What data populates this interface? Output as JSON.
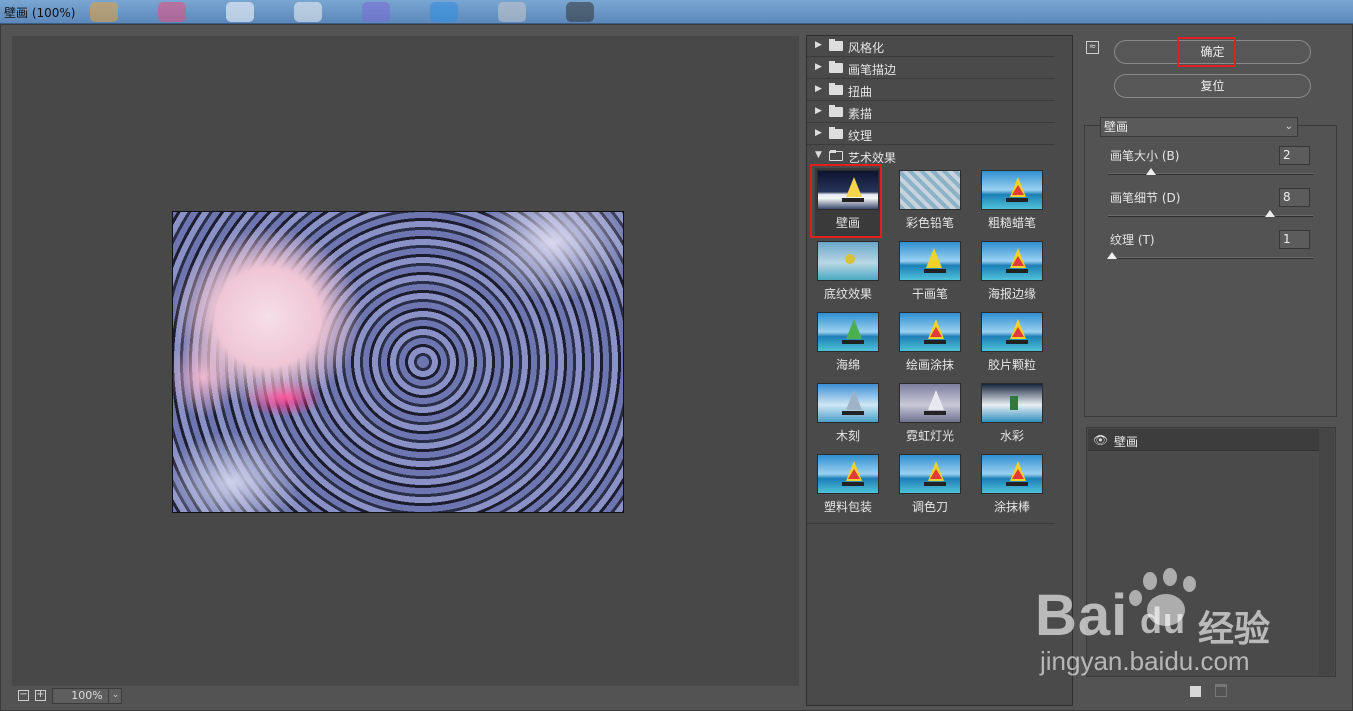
{
  "window": {
    "title": "壁画 (100%)"
  },
  "preview": {
    "zoom": "100%",
    "zoom_out": "−",
    "zoom_in": "+",
    "dropdown": "⌄"
  },
  "gallery": {
    "folders": [
      {
        "label": "风格化",
        "arrow": "▶"
      },
      {
        "label": "画笔描边",
        "arrow": "▶"
      },
      {
        "label": "扭曲",
        "arrow": "▶"
      },
      {
        "label": "素描",
        "arrow": "▶"
      },
      {
        "label": "纹理",
        "arrow": "▶"
      },
      {
        "label": "艺术效果",
        "arrow": "▼"
      }
    ],
    "filters": [
      "壁画",
      "彩色铅笔",
      "粗糙蜡笔",
      "底纹效果",
      "干画笔",
      "海报边缘",
      "海绵",
      "绘画涂抹",
      "胶片颗粒",
      "木刻",
      "霓虹灯光",
      "水彩",
      "塑料包装",
      "调色刀",
      "涂抹棒"
    ],
    "selected": "壁画"
  },
  "buttons": {
    "ok": "确定",
    "reset": "复位",
    "collapse": "≈"
  },
  "settings": {
    "filter_select": "壁画",
    "select_chevron": "⌄",
    "params": [
      {
        "label": "画笔大小 (B)",
        "value": "2",
        "fraction": 0.2
      },
      {
        "label": "画笔细节 (D)",
        "value": "8",
        "fraction": 0.8
      },
      {
        "label": "纹理 (T)",
        "value": "1",
        "fraction": 0.0
      }
    ]
  },
  "layers": {
    "items": [
      {
        "name": "壁画",
        "eye": "👁"
      }
    ]
  },
  "watermark": {
    "brand": "Bai",
    "du": "du",
    "cn": "经验",
    "url": "jingyan.baidu.com"
  },
  "colors": {
    "highlight": "#e02020",
    "panel": "#535353",
    "dark": "#4a4a4a"
  }
}
